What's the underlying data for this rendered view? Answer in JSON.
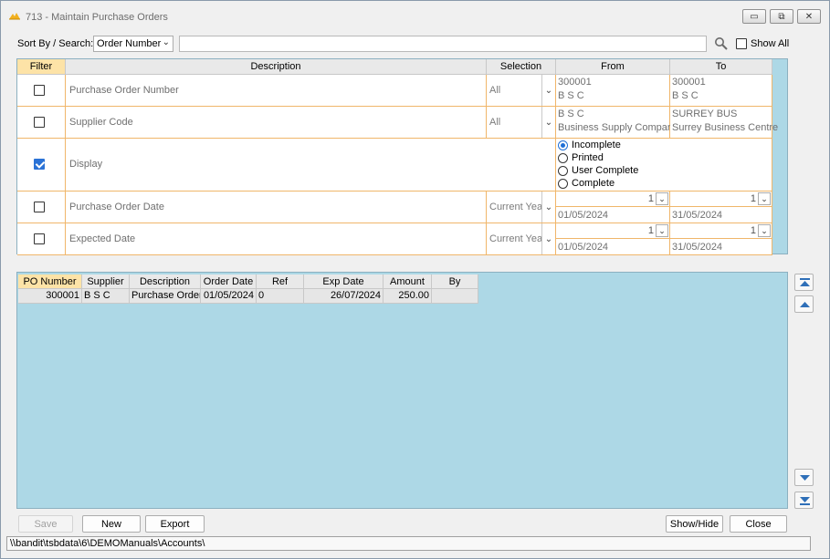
{
  "window": {
    "title": "713 - Maintain Purchase Orders",
    "controls": {
      "minimize": "▭",
      "restore": "⧉",
      "close": "✕"
    }
  },
  "toolbar": {
    "sort_label": "Sort By / Search:",
    "sort_value": "Order Number",
    "search_value": "",
    "show_all_label": "Show All",
    "show_all_checked": false
  },
  "filter_grid": {
    "headers": {
      "filter": "Filter",
      "description": "Description",
      "selection": "Selection",
      "from": "From",
      "to": "To"
    },
    "rows": [
      {
        "checked": false,
        "description": "Purchase Order Number",
        "selection": "All",
        "from": [
          "300001",
          "B S C"
        ],
        "to": [
          "300001",
          "B S C"
        ]
      },
      {
        "checked": false,
        "description": "Supplier Code",
        "selection": "All",
        "from": [
          "B S C",
          "Business Supply Company"
        ],
        "to": [
          "SURREY BUS",
          "Surrey Business Centre"
        ]
      },
      {
        "checked": true,
        "description": "Display",
        "options": [
          {
            "label": "Incomplete",
            "selected": true
          },
          {
            "label": "Printed",
            "selected": false
          },
          {
            "label": "User Complete",
            "selected": false
          },
          {
            "label": "Complete",
            "selected": false
          }
        ]
      },
      {
        "checked": false,
        "description": "Purchase Order Date",
        "selection": "Current Year",
        "from_spin": "1",
        "to_spin": "1",
        "from_date": "01/05/2024",
        "to_date": "31/05/2024"
      },
      {
        "checked": false,
        "description": "Expected Date",
        "selection": "Current Year",
        "from_spin": "1",
        "to_spin": "1",
        "from_date": "01/05/2024",
        "to_date": "31/05/2024"
      }
    ]
  },
  "orders": {
    "columns": [
      "PO Number",
      "Supplier",
      "Description",
      "Order Date",
      "Ref",
      "Exp Date",
      "Amount",
      "By"
    ],
    "rows": [
      [
        "300001",
        "B S C",
        "Purchase Order",
        "01/05/2024",
        "0",
        "26/07/2024",
        "250.00",
        ""
      ]
    ]
  },
  "buttons": {
    "save": "Save",
    "new": "New",
    "export": "Export",
    "show_hide": "Show/Hide",
    "close": "Close"
  },
  "status": {
    "path": "\\\\bandit\\tsbdata\\6\\DEMOManuals\\Accounts\\"
  },
  "colors": {
    "panel": "#add8e6",
    "header_active": "#fde3a7",
    "row_border": "#f0b66a",
    "check": "#2a72d6"
  },
  "icons": {
    "search": "magnifier-icon",
    "nav": [
      "first-page-icon",
      "previous-page-icon",
      "next-page-icon",
      "last-page-icon"
    ]
  }
}
